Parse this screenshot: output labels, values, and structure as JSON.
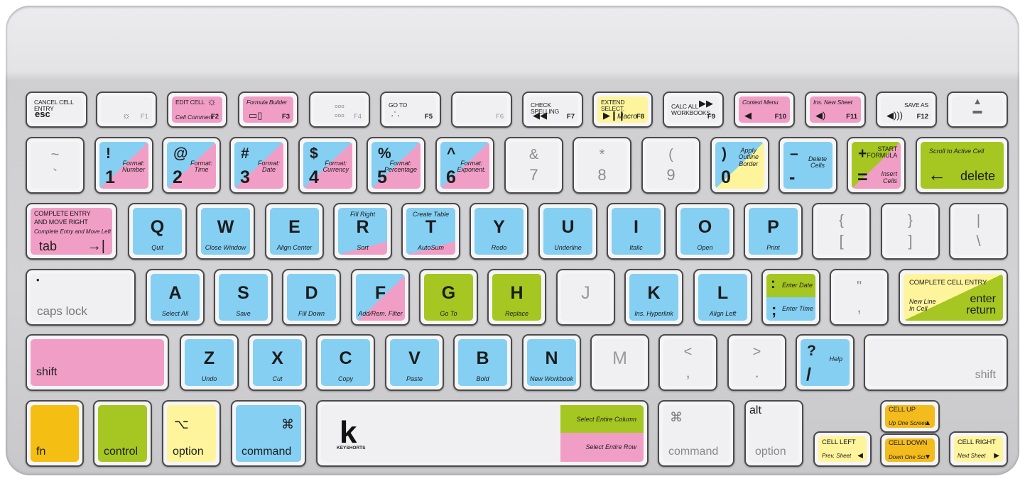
{
  "colors": {
    "blue": "#85cff3",
    "pink": "#f19ec6",
    "green": "#a6c622",
    "yellow": "#fef49c",
    "orange": "#f5be13",
    "amber": "#f3bb1c",
    "gray": "#f0f0f2"
  },
  "brand": "KEYSHORTS",
  "keys": {
    "esc": {
      "face": "gray",
      "title": "CANCEL CELL ENTRY",
      "word": "esc"
    },
    "f1": {
      "face": "gray",
      "icon": "brightness-down-icon",
      "fkey": "F1"
    },
    "f2": {
      "face": "pink",
      "title": "EDIT CELL",
      "icon": "brightness-up-icon",
      "act": "Cell Comment",
      "fkey": "F2"
    },
    "f3": {
      "face": "pink",
      "title": "Formula Builder",
      "icon": "mission-control-icon",
      "fkey": "F3"
    },
    "f4": {
      "face": "gray",
      "icon": "launchpad-icon",
      "fkey": "F4"
    },
    "f5": {
      "face": "gray",
      "title": "GO TO",
      "icon": "keyboard-light-down-icon",
      "fkey": "F5"
    },
    "f6": {
      "face": "gray",
      "fkey": "F6"
    },
    "f7": {
      "face": "gray",
      "title": "CHECK SPELLING",
      "icon": "rewind-icon",
      "fkey": "F7"
    },
    "f8": {
      "face": "yellow",
      "title": "EXTEND SELECT.",
      "icon": "play-pause-icon",
      "act": "Macro",
      "fkey": "F8"
    },
    "f9": {
      "face": "gray",
      "title": "CALC ALL WORKBOOKS",
      "icon": "fast-forward-icon",
      "fkey": "F9"
    },
    "f10": {
      "face": "pink",
      "title": "Context Menu",
      "icon": "mute-icon",
      "fkey": "F10"
    },
    "f11": {
      "face": "pink",
      "title": "Ins. New Sheet",
      "icon": "volume-down-icon",
      "fkey": "F11"
    },
    "f12": {
      "face": "gray",
      "title": "SAVE AS",
      "icon": "volume-up-icon",
      "fkey": "F12"
    },
    "eject": {
      "face": "gray",
      "icon": "eject-icon"
    },
    "tilde": {
      "face": "gray",
      "sym": "~",
      "num": "`"
    },
    "1": {
      "face": "blue|pink",
      "sym": "!",
      "num": "1",
      "act": "Format:\nNumber"
    },
    "2": {
      "face": "blue|pink",
      "sym": "@",
      "num": "2",
      "act": "Format:\nTime"
    },
    "3": {
      "face": "blue|pink",
      "sym": "#",
      "num": "3",
      "act": "Format:\nDate"
    },
    "4": {
      "face": "blue|pink",
      "sym": "$",
      "num": "4",
      "act": "Format:\nCurrency"
    },
    "5": {
      "face": "blue|pink",
      "sym": "%",
      "num": "5",
      "act": "Format:\nPercentage"
    },
    "6": {
      "face": "blue|pink",
      "sym": "^",
      "num": "6",
      "act": "Format:\nExponent."
    },
    "7": {
      "face": "gray",
      "sym": "&",
      "num": "7"
    },
    "8": {
      "face": "gray",
      "sym": "*",
      "num": "8"
    },
    "9": {
      "face": "gray",
      "sym": "(",
      "num": "9"
    },
    "0": {
      "face": "blue|yellow",
      "sym": ")",
      "num": "0",
      "act": "Apply\nOutline\nBorder"
    },
    "minus": {
      "face": "blue",
      "sym": "–",
      "num": "-",
      "act": "Delete\nCells"
    },
    "equal": {
      "face": "green|pink",
      "sym": "+",
      "num": "=",
      "title": "START\nFORMULA",
      "act": "Insert\nCells"
    },
    "delete": {
      "face": "green",
      "top": "Scroll to Active Cell",
      "icon": "arrow-left-icon",
      "word": "delete"
    },
    "tab": {
      "face": "pink",
      "title": "COMPLETE ENTRY\nAND MOVE RIGHT",
      "top2": "Complete Entry and Move Left",
      "word": "tab",
      "icon": "tab-arrow-icon"
    },
    "q": {
      "face": "blue",
      "main": "Q",
      "sub": "Quit"
    },
    "w": {
      "face": "blue",
      "main": "W",
      "sub": "Close Window"
    },
    "e": {
      "face": "blue",
      "main": "E",
      "sub": "Align Center"
    },
    "r": {
      "face": "blue^pink",
      "top": "Fill Right",
      "main": "R",
      "sub": "Sort"
    },
    "t": {
      "face": "blue^pink",
      "top": "Create Table",
      "main": "T",
      "sub": "AutoSum"
    },
    "y": {
      "face": "blue",
      "main": "Y",
      "sub": "Redo"
    },
    "u": {
      "face": "blue",
      "main": "U",
      "sub": "Underline"
    },
    "i": {
      "face": "blue",
      "main": "I",
      "sub": "Italic"
    },
    "o": {
      "face": "blue",
      "main": "O",
      "sub": "Open"
    },
    "p": {
      "face": "blue",
      "main": "P",
      "sub": "Print"
    },
    "lbracket": {
      "face": "gray",
      "sym": "{",
      "num": "["
    },
    "rbracket": {
      "face": "gray",
      "sym": "}",
      "num": "]"
    },
    "backslash": {
      "face": "gray",
      "sym": "|",
      "num": "\\"
    },
    "caps": {
      "face": "gray",
      "icon": "caps-light-icon",
      "word": "caps lock"
    },
    "a": {
      "face": "blue",
      "main": "A",
      "sub": "Select All"
    },
    "s": {
      "face": "blue",
      "main": "S",
      "sub": "Save"
    },
    "d": {
      "face": "blue",
      "main": "D",
      "sub": "Fill Down"
    },
    "f": {
      "face": "blue/pink",
      "main": "F",
      "sub": "Add/Rem. Filter"
    },
    "g": {
      "face": "green",
      "main": "G",
      "sub": "Go To"
    },
    "h": {
      "face": "green",
      "main": "H",
      "sub": "Replace"
    },
    "j": {
      "face": "gray",
      "main": "J"
    },
    "k": {
      "face": "blue",
      "main": "K",
      "sub": "Ins. Hyperlink"
    },
    "l": {
      "face": "blue",
      "main": "L",
      "sub": "Align Left"
    },
    "semi": {
      "face": "green-blue",
      "sym": ":",
      "act": "Enter Date",
      "num": ";",
      "act2": "Enter Time"
    },
    "quote": {
      "face": "gray",
      "sym": "\"",
      "num": ","
    },
    "return": {
      "face": "yellow|green",
      "title": "COMPLETE CELL ENTRY",
      "act": "New Line\nIn Cell",
      "word": "enter\nreturn"
    },
    "lshift": {
      "face": "pink",
      "word": "shift"
    },
    "z": {
      "face": "blue",
      "main": "Z",
      "sub": "Undo"
    },
    "x": {
      "face": "blue",
      "main": "X",
      "sub": "Cut"
    },
    "c": {
      "face": "blue",
      "main": "C",
      "sub": "Copy"
    },
    "v": {
      "face": "blue",
      "main": "V",
      "sub": "Paste"
    },
    "b": {
      "face": "blue",
      "main": "B",
      "sub": "Bold"
    },
    "n": {
      "face": "blue",
      "main": "N",
      "sub": "New Workbook"
    },
    "m": {
      "face": "gray",
      "main": "M"
    },
    "comma": {
      "face": "gray",
      "sym": "<",
      "num": ","
    },
    "period": {
      "face": "gray",
      "sym": ">",
      "num": "."
    },
    "slash": {
      "face": "blue",
      "sym": "?",
      "num": "/",
      "act": "Help"
    },
    "rshift": {
      "face": "gray",
      "word": "shift"
    },
    "fn": {
      "face": "orange",
      "word": "fn"
    },
    "control": {
      "face": "green",
      "word": "control"
    },
    "option": {
      "face": "yellow",
      "icon": "option-icon",
      "word": "option"
    },
    "command": {
      "face": "blue",
      "icon": "command-icon",
      "word": "command"
    },
    "space": {
      "face": "gray",
      "logo": "k",
      "brand": "KEYSHORTS",
      "col": "Select Entire Column",
      "row": "Select Entire Row"
    },
    "rcommand": {
      "face": "gray",
      "icon": "command-icon",
      "word": "command"
    },
    "roption": {
      "face": "gray",
      "alt": "alt",
      "word": "option"
    },
    "left": {
      "face": "yellow",
      "title": "CELL LEFT",
      "act": "Prev. Sheet",
      "icon": "triangle-left-icon"
    },
    "up": {
      "face": "amber",
      "title": "CELL UP",
      "act": "Up One Screen",
      "icon": "triangle-up-icon"
    },
    "down": {
      "face": "amber",
      "title": "CELL DOWN",
      "act": "Down One Scr.",
      "icon": "triangle-down-icon"
    },
    "right": {
      "face": "yellow",
      "title": "CELL RIGHT",
      "act": "Next Sheet",
      "icon": "triangle-right-icon"
    }
  }
}
